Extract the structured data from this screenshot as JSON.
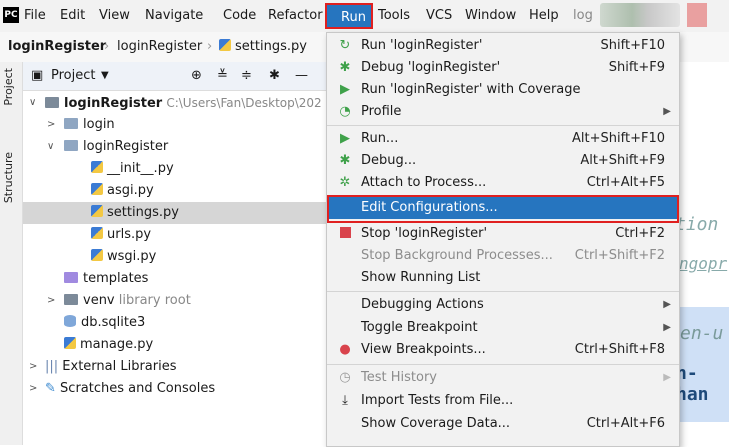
{
  "menubar": {
    "items": [
      {
        "label": "File",
        "mnemonic": "F"
      },
      {
        "label": "Edit",
        "mnemonic": "E"
      },
      {
        "label": "View",
        "mnemonic": "V"
      },
      {
        "label": "Navigate",
        "mnemonic": "N"
      },
      {
        "label": "Code",
        "mnemonic": "C"
      },
      {
        "label": "Refactor",
        "mnemonic": ""
      },
      {
        "label": "Run",
        "mnemonic": "u"
      },
      {
        "label": "Tools",
        "mnemonic": "T"
      },
      {
        "label": "VCS",
        "mnemonic": ""
      },
      {
        "label": "Window",
        "mnemonic": "W"
      },
      {
        "label": "Help",
        "mnemonic": "H"
      }
    ],
    "project_short": "log"
  },
  "breadcrumbs": [
    "loginRegister",
    "loginRegister",
    "settings.py"
  ],
  "side_tabs": [
    "Project",
    "Structure"
  ],
  "project_panel": {
    "title": "Project",
    "tree": [
      {
        "label": "loginRegister",
        "extra": "C:\\Users\\Fan\\Desktop\\202"
      },
      {
        "label": "login"
      },
      {
        "label": "loginRegister"
      },
      {
        "label": "__init__.py"
      },
      {
        "label": "asgi.py"
      },
      {
        "label": "settings.py"
      },
      {
        "label": "urls.py"
      },
      {
        "label": "wsgi.py"
      },
      {
        "label": "templates"
      },
      {
        "label": "venv",
        "extra": "library root"
      },
      {
        "label": "db.sqlite3"
      },
      {
        "label": "manage.py"
      },
      {
        "label": "External Libraries"
      },
      {
        "label": "Scratches and Consoles"
      }
    ]
  },
  "editor_fragments": [
    "tion",
    "ngopr",
    "en-u",
    "n-han"
  ],
  "run_menu": {
    "items": [
      {
        "label": "Run 'loginRegister'",
        "shortcut": "Shift+F10"
      },
      {
        "label": "Debug 'loginRegister'",
        "shortcut": "Shift+F9"
      },
      {
        "label": "Run 'loginRegister' with Coverage",
        "shortcut": ""
      },
      {
        "label": "Profile",
        "shortcut": ""
      },
      {
        "label": "Run...",
        "shortcut": "Alt+Shift+F10"
      },
      {
        "label": "Debug...",
        "shortcut": "Alt+Shift+F9"
      },
      {
        "label": "Attach to Process...",
        "shortcut": "Ctrl+Alt+F5"
      },
      {
        "label": "Edit Configurations...",
        "shortcut": ""
      },
      {
        "label": "Stop 'loginRegister'",
        "shortcut": "Ctrl+F2"
      },
      {
        "label": "Stop Background Processes...",
        "shortcut": "Ctrl+Shift+F2"
      },
      {
        "label": "Show Running List",
        "shortcut": ""
      },
      {
        "label": "Debugging Actions",
        "shortcut": ""
      },
      {
        "label": "Toggle Breakpoint",
        "shortcut": ""
      },
      {
        "label": "View Breakpoints...",
        "shortcut": "Ctrl+Shift+F8"
      },
      {
        "label": "Test History",
        "shortcut": ""
      },
      {
        "label": "Import Tests from File...",
        "shortcut": ""
      },
      {
        "label": "Show Coverage Data...",
        "shortcut": "Ctrl+Alt+F6"
      }
    ]
  },
  "colors": {
    "highlight": "#2675bf",
    "annotation": "#e02020"
  }
}
